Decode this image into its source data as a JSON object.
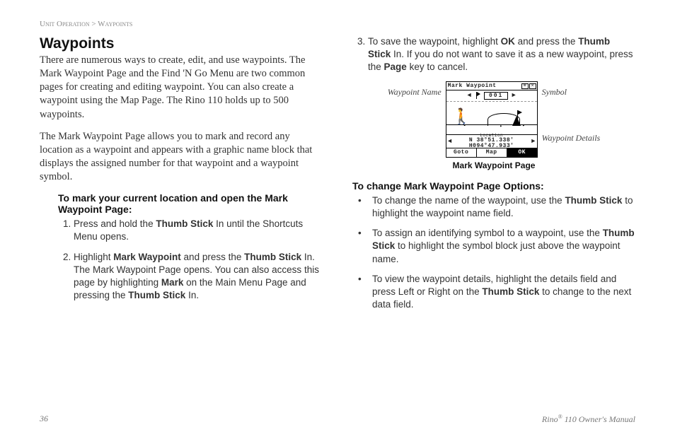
{
  "breadcrumb": {
    "section": "Unit Operation",
    "sep": " > ",
    "page": "Waypoints"
  },
  "left": {
    "h1": "Waypoints",
    "p1": "There are numerous ways to create, edit, and use waypoints. The Mark Waypoint Page and the Find 'N Go Menu are two common pages for creating and editing waypoint. You can also create a waypoint using the Map Page. The Rino 110 holds up to 500 waypoints.",
    "p2": "The Mark Waypoint Page allows you to mark and record any location as a waypoint and appears with a graphic name block that displays the assigned number for that waypoint and a waypoint symbol.",
    "instrHead": "To mark your current location and open the Mark Waypoint Page:",
    "step1": {
      "a": "Press and hold the ",
      "b1": "Thumb Stick",
      "c": " In until the Shortcuts Menu opens."
    },
    "step2": {
      "a": "Highlight ",
      "b1": "Mark Waypoint",
      "c": " and press the ",
      "b2": "Thumb Stick",
      "d": " In. The Mark Waypoint Page opens. You can also access this page by highlighting ",
      "b3": "Mark",
      "e": " on the Main Menu Page and pressing the ",
      "b4": "Thumb Stick",
      "f": " In."
    }
  },
  "right": {
    "step3": {
      "a": "To save the waypoint, highlight ",
      "b1": "OK",
      "c": " and press the ",
      "b2": "Thumb Stick",
      "d": " In. If you do not want to save it as a new waypoint, press the ",
      "b3": "Page",
      "e": " key to cancel."
    },
    "figure": {
      "leftLabel": "Waypoint Name",
      "rightLabelTop": "Symbol",
      "rightLabelBottom": "Waypoint Details",
      "title": "Mark Waypoint",
      "wpNum": "001",
      "locLabel": "Location",
      "coord1": "N 38°51.338'",
      "coord2": "H094°47.933'",
      "btn1": "Goto",
      "btn2": "Map",
      "btn3": "OK",
      "caption": "Mark Waypoint Page"
    },
    "instrHead": "To change Mark Waypoint Page Options:",
    "b1": {
      "a": "To change the name of the waypoint, use the ",
      "b1": "Thumb Stick",
      "c": " to highlight the waypoint name field."
    },
    "b2": {
      "a": "To assign an identifying symbol to a waypoint, use the ",
      "b1": "Thumb Stick",
      "c": " to highlight the symbol block just above the waypoint name."
    },
    "b3": {
      "a": "To view the waypoint details, highlight the details field and press Left or Right on the ",
      "b1": "Thumb Stick",
      "c": " to change to the next data field."
    }
  },
  "footer": {
    "pageNum": "36",
    "bookA": "Rino",
    "bookSup": "®",
    "bookB": " 110 Owner's Manual"
  }
}
